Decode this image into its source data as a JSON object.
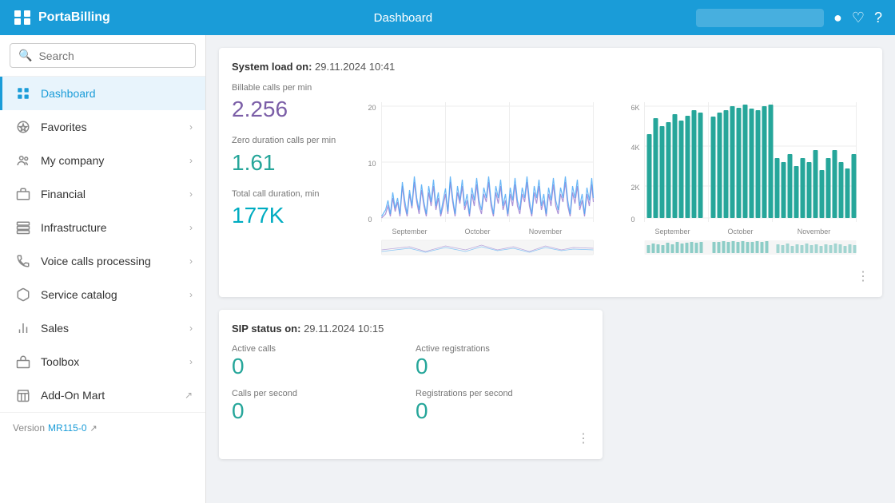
{
  "app": {
    "brand": "PortaBilling",
    "page_title": "Dashboard",
    "nav_search_placeholder": ""
  },
  "sidebar": {
    "search_placeholder": "Search",
    "items": [
      {
        "id": "dashboard",
        "label": "Dashboard",
        "icon": "grid-icon",
        "active": true,
        "has_children": false
      },
      {
        "id": "favorites",
        "label": "Favorites",
        "icon": "star-icon",
        "active": false,
        "has_children": true
      },
      {
        "id": "my-company",
        "label": "My company",
        "icon": "users-icon",
        "active": false,
        "has_children": true
      },
      {
        "id": "financial",
        "label": "Financial",
        "icon": "briefcase-icon",
        "active": false,
        "has_children": true
      },
      {
        "id": "infrastructure",
        "label": "Infrastructure",
        "icon": "server-icon",
        "active": false,
        "has_children": true
      },
      {
        "id": "voice-calls",
        "label": "Voice calls processing",
        "icon": "phone-icon",
        "active": false,
        "has_children": true
      },
      {
        "id": "service-catalog",
        "label": "Service catalog",
        "icon": "cube-icon",
        "active": false,
        "has_children": true
      },
      {
        "id": "sales",
        "label": "Sales",
        "icon": "chart-icon",
        "active": false,
        "has_children": true
      },
      {
        "id": "toolbox",
        "label": "Toolbox",
        "icon": "toolbox-icon",
        "active": false,
        "has_children": true
      },
      {
        "id": "addon-mart",
        "label": "Add-On Mart",
        "icon": "store-icon",
        "active": false,
        "has_children": false,
        "external": true
      }
    ],
    "version_label": "Version",
    "version_value": "MR115-0"
  },
  "system_load": {
    "title": "System load on:",
    "datetime": " 29.11.2024 10:41",
    "metrics": [
      {
        "id": "billable-calls",
        "label": "Billable calls per min",
        "value": "2.256",
        "color": "purple"
      },
      {
        "id": "zero-duration",
        "label": "Zero duration calls per min",
        "value": "1.61",
        "color": "teal"
      },
      {
        "id": "total-duration",
        "label": "Total call duration, min",
        "value": "177K",
        "color": "cyan"
      }
    ],
    "chart_x_labels": [
      "September",
      "October",
      "November"
    ],
    "bar_chart_y_labels": [
      "6K",
      "4K",
      "2K",
      "0"
    ],
    "line_chart_y_labels": [
      "20",
      "10",
      "0"
    ]
  },
  "sip_status": {
    "title": "SIP status on:",
    "datetime": " 29.11.2024 10:15",
    "metrics": [
      {
        "id": "active-calls",
        "label": "Active calls",
        "value": "0",
        "color": "teal"
      },
      {
        "id": "active-registrations",
        "label": "Active registrations",
        "value": "0",
        "color": "teal"
      },
      {
        "id": "calls-per-second",
        "label": "Calls per second",
        "value": "0",
        "color": "teal"
      },
      {
        "id": "registrations-per-second",
        "label": "Registrations per second",
        "value": "0",
        "color": "teal"
      }
    ]
  }
}
